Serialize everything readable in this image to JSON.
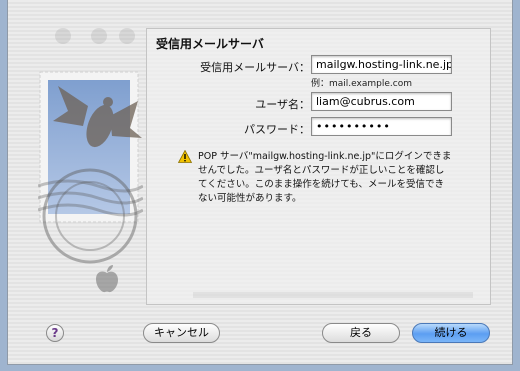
{
  "panel": {
    "title": "受信用メールサーバ"
  },
  "form": {
    "server_label": "受信用メールサーバ：",
    "server_value": "mailgw.hosting-link.ne.jp",
    "server_hint": "例：mail.example.com",
    "username_label": "ユーザ名：",
    "username_value": "liam@cubrus.com",
    "password_label": "パスワード：",
    "password_value": "••••••••••"
  },
  "warning": {
    "message": "POP サーバ\"mailgw.hosting-link.ne.jp\"にログインできませんでした。ユーザ名とパスワードが正しいことを確認してください。このまま操作を続けても、メールを受信できない可能性があります。"
  },
  "buttons": {
    "help": "?",
    "cancel": "キャンセル",
    "back": "戻る",
    "continue": "続ける"
  },
  "colors": {
    "accent": "#5c9ef2",
    "warning": "#f2c200"
  }
}
